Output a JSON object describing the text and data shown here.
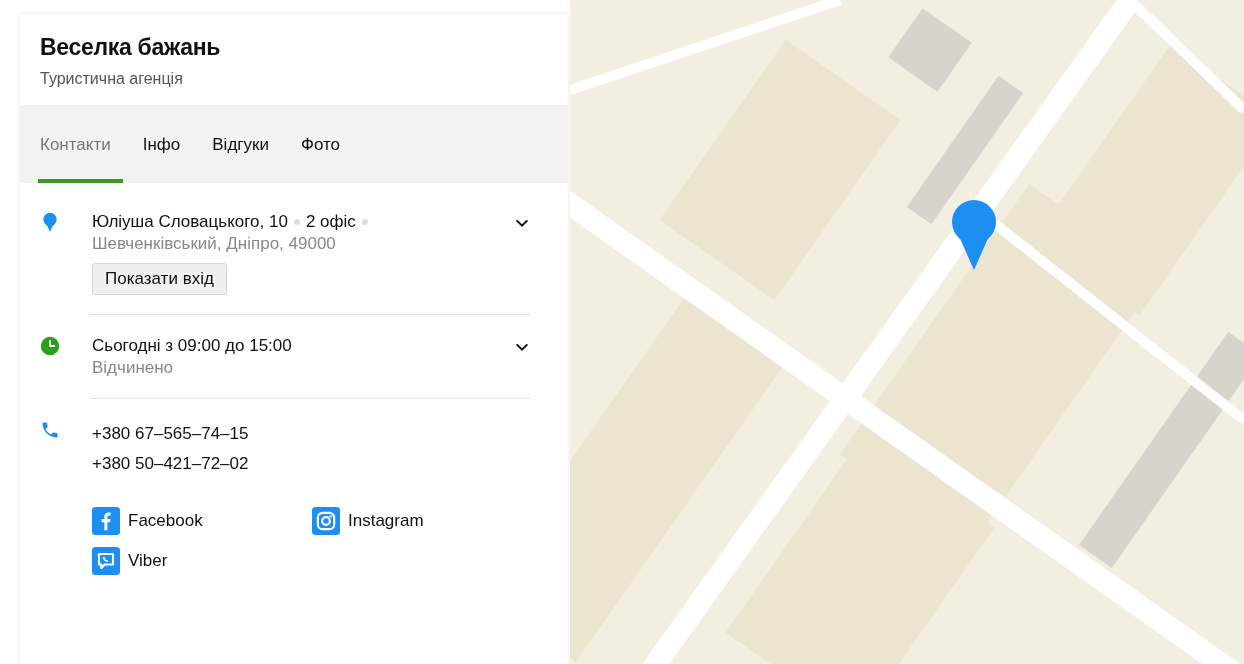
{
  "place": {
    "title": "Веселка бажань",
    "category": "Туристична агенція"
  },
  "tabs": [
    {
      "label": "Контакти",
      "selected": true
    },
    {
      "label": "Інфо",
      "selected": false
    },
    {
      "label": "Відгуки",
      "selected": false
    },
    {
      "label": "Фото",
      "selected": false
    }
  ],
  "address": {
    "street": "Юліуша Словацького, 10",
    "office": "2 офіс",
    "locality": "Шевченківський, Дніпро, 49000",
    "button": "Показати вхід",
    "expanded": false
  },
  "hours": {
    "today": "Сьогодні з 09:00 до 15:00",
    "status": "Відчинено",
    "expanded": false
  },
  "phones": [
    "+380 67–565–74–15",
    "+380 50–421–72–02"
  ],
  "social": [
    {
      "kind": "facebook",
      "label": "Facebook"
    },
    {
      "kind": "instagram",
      "label": "Instagram"
    },
    {
      "kind": "viber",
      "label": "Viber"
    }
  ]
}
